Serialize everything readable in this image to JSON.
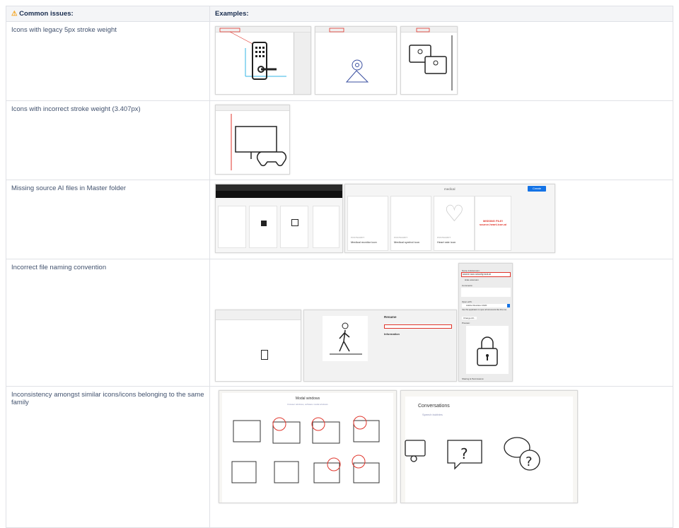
{
  "table": {
    "headers": {
      "issues": "Common issues:",
      "examples": "Examples:"
    },
    "rows": [
      {
        "issue": "Icons with legacy 5px stroke weight"
      },
      {
        "issue": "Icons with incorrect stroke weight (3.407px)"
      },
      {
        "issue": "Missing source AI files in Master folder"
      },
      {
        "issue": "Incorrect file naming convention"
      },
      {
        "issue": "Inconsistency amongst similar icons/icons belonging to the same family"
      }
    ]
  },
  "examples": {
    "medical": {
      "folder": "medical",
      "create": "Create",
      "cards": [
        {
          "type": "POSTSCRIPT",
          "title": "Medical monitor icon"
        },
        {
          "type": "POSTSCRIPT",
          "title": "Medical symbol icon"
        },
        {
          "type": "POSTSCRIPT",
          "title": "Heart rate icon"
        }
      ],
      "missing": "MISSING FILE! source-heart-icon.ai"
    },
    "rename": {
      "title": "Rename",
      "info": "Information"
    },
    "finder": {
      "name_section": "Name & Extension:",
      "filename": "source-icon-security-lock.ai",
      "hide_ext": "Hide extension",
      "comments": "Comments:",
      "open_with": "Open with:",
      "app": "Adobe Illustrator 2020",
      "open_desc": "Use this application to open all documents like this one.",
      "change_all": "Change All...",
      "preview": "Preview:",
      "sharing": "Sharing & Permissions:"
    },
    "modal": {
      "title": "Modal windows",
      "subtitle": "browser windows, software modal windows"
    },
    "conversations": {
      "title": "Conversations",
      "subtitle": "Speech bubbles"
    }
  },
  "colors": {
    "warning": "#f5a623",
    "highlight": "#e0352b",
    "accent": "#1473e6"
  }
}
